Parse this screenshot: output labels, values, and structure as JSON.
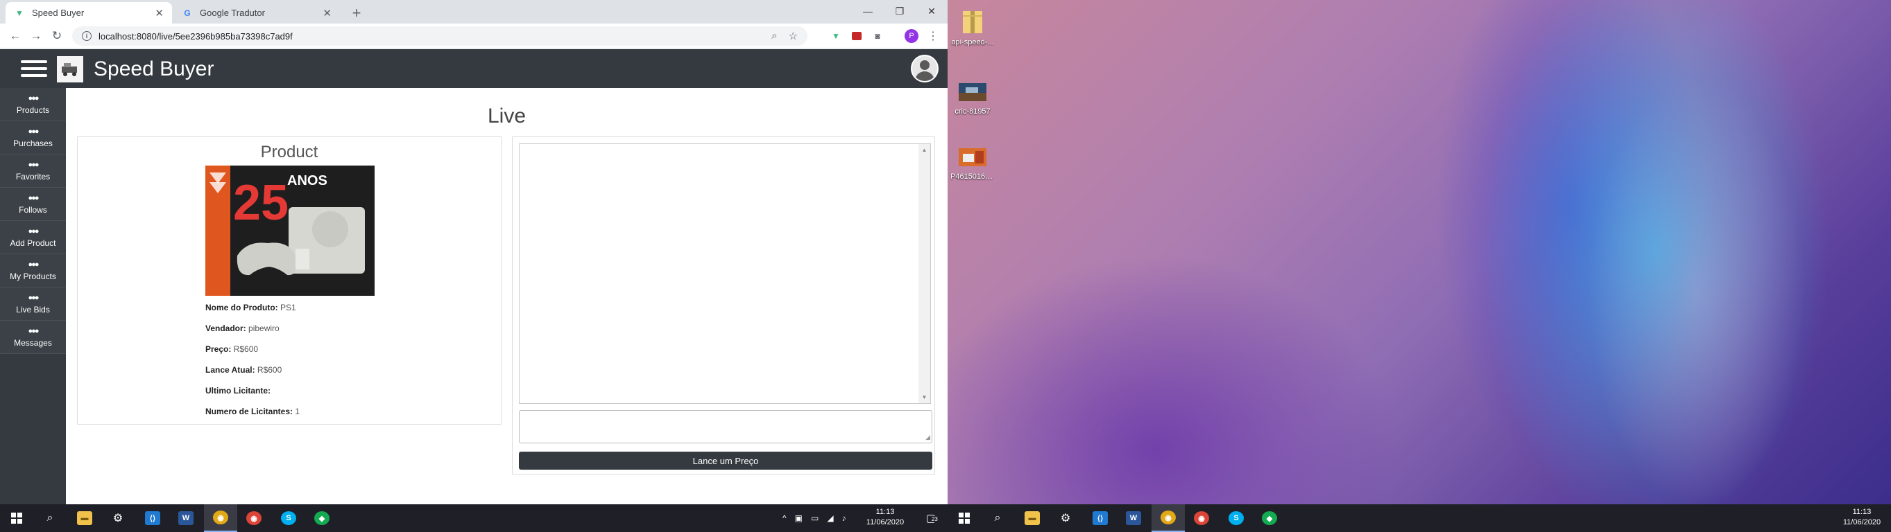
{
  "browser": {
    "tabs": [
      {
        "title": "Speed Buyer",
        "active": true
      },
      {
        "title": "Google Tradutor",
        "active": false
      }
    ],
    "url": "localhost:8080/live/5ee2396b985ba73398c7ad9f",
    "profile_initial": "P"
  },
  "app": {
    "title": "Speed Buyer",
    "sidebar": [
      {
        "label": "Products",
        "icon": "users-icon"
      },
      {
        "label": "Purchases",
        "icon": "users-icon"
      },
      {
        "label": "Favorites",
        "icon": "users-icon"
      },
      {
        "label": "Follows",
        "icon": "users-icon"
      },
      {
        "label": "Add Product",
        "icon": "users-icon"
      },
      {
        "label": "My Products",
        "icon": "users-icon"
      },
      {
        "label": "Live Bids",
        "icon": "users-icon"
      },
      {
        "label": "Messages",
        "icon": "users-icon"
      }
    ],
    "page_title": "Live",
    "product": {
      "card_title": "Product",
      "image_text": {
        "number": "25",
        "word": "ANOS"
      },
      "fields": [
        {
          "label": "Nome do Produto:",
          "value": "PS1"
        },
        {
          "label": "Vendador:",
          "value": "pibewiro"
        },
        {
          "label": "Preço:",
          "value": "R$600"
        },
        {
          "label": "Lance Atual:",
          "value": "R$600"
        },
        {
          "label": "Ultimo Licitante:",
          "value": ""
        },
        {
          "label": "Numero de Licitantes:",
          "value": "1"
        }
      ]
    },
    "live": {
      "bid_input_value": "",
      "bid_button_label": "Lance um Preço"
    }
  },
  "taskbar_left": {
    "clock_time": "11:13",
    "clock_date": "11/06/2020",
    "notification_count": "23"
  },
  "taskbar_right": {
    "clock_time": "11:13",
    "clock_date": "11/06/2020"
  },
  "desktop_icons": [
    {
      "label": "api-speed-..."
    },
    {
      "label": "cric-81957"
    },
    {
      "label": "P4615016_1..."
    }
  ],
  "colors": {
    "app_dark": "#343a40",
    "taskbar": "#1f2027",
    "chrome_accent": "#8ab4f8"
  }
}
